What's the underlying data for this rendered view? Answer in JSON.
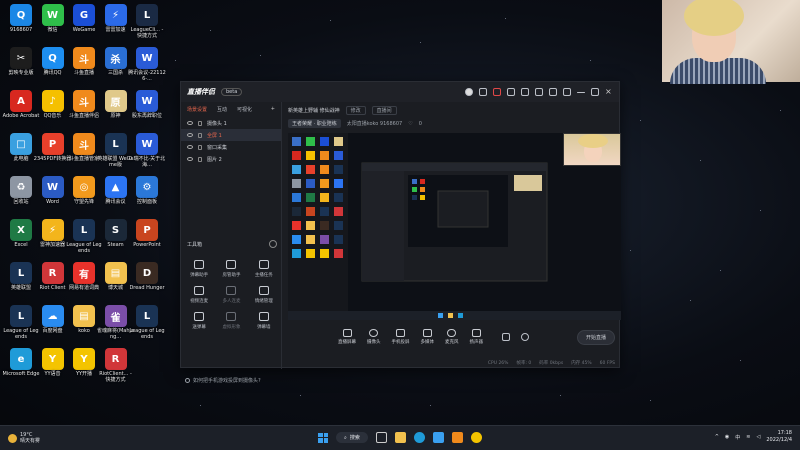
{
  "desktop": {
    "icons": [
      {
        "label": "9168607",
        "color": "#1b87e6",
        "glyph": "Q"
      },
      {
        "label": "微信",
        "color": "#2fbf4a",
        "glyph": "W"
      },
      {
        "label": "WeGame",
        "color": "#1b4fd6",
        "glyph": "G"
      },
      {
        "label": "雷雷加速",
        "color": "#2b6ae8",
        "glyph": "⚡"
      },
      {
        "label": "LeagueCli... - 快捷方式",
        "color": "#1a2a44",
        "glyph": "L"
      },
      {
        "label": "剪映专业版",
        "color": "#1d1d1d",
        "glyph": "✂"
      },
      {
        "label": "腾讯QQ",
        "color": "#1d8ef0",
        "glyph": "Q"
      },
      {
        "label": "斗鱼直播",
        "color": "#f08a1c",
        "glyph": "斗"
      },
      {
        "label": "三国杀",
        "color": "#2a6fd4",
        "glyph": "杀"
      },
      {
        "label": "腾讯会议-221126-...",
        "color": "#2a5bd7",
        "glyph": "W"
      },
      {
        "label": "Adobe Acrobat",
        "color": "#d8281f",
        "glyph": "A"
      },
      {
        "label": "QQ音乐",
        "color": "#f5c000",
        "glyph": "♪"
      },
      {
        "label": "斗鱼直播伴侣",
        "color": "#f08a1c",
        "glyph": "斗"
      },
      {
        "label": "原神",
        "color": "#e0c98a",
        "glyph": "原"
      },
      {
        "label": "股东再辞职位",
        "color": "#2a5bd7",
        "glyph": "W"
      },
      {
        "label": "此电脑",
        "color": "#3aa0e0",
        "glyph": "□"
      },
      {
        "label": "2345PDF转换器",
        "color": "#e8402b",
        "glyph": "P"
      },
      {
        "label": "斗鱼直播管家",
        "color": "#f08a1c",
        "glyph": "斗"
      },
      {
        "label": "英雄联盟 WeGame版",
        "color": "#1a3354",
        "glyph": "L"
      },
      {
        "label": "0 瑞不比·关于北海…",
        "color": "#2a5bd7",
        "glyph": "W"
      },
      {
        "label": "回收站",
        "color": "#8d96a3",
        "glyph": "♻"
      },
      {
        "label": "Word",
        "color": "#2b5bc4",
        "glyph": "W"
      },
      {
        "label": "守望先锋",
        "color": "#f29a1d",
        "glyph": "◎"
      },
      {
        "label": "腾讯会议",
        "color": "#2c74f2",
        "glyph": "▲"
      },
      {
        "label": "控制面板",
        "color": "#2b78d8",
        "glyph": "⚙"
      },
      {
        "label": "Excel",
        "color": "#1f7a45",
        "glyph": "X"
      },
      {
        "label": "雷神加速器",
        "color": "#f3b51c",
        "glyph": "⚡"
      },
      {
        "label": "League of Legends",
        "color": "#1a3354",
        "glyph": "L"
      },
      {
        "label": "Steam",
        "color": "#1b2838",
        "glyph": "S"
      },
      {
        "label": "PowerPoint",
        "color": "#c9451f",
        "glyph": "P"
      },
      {
        "label": "英雄联盟",
        "color": "#1a3354",
        "glyph": "L"
      },
      {
        "label": "Riot Client",
        "color": "#d13639",
        "glyph": "R"
      },
      {
        "label": "网易有道词典",
        "color": "#e8322b",
        "glyph": "有"
      },
      {
        "label": "博天城",
        "color": "#f2c14e",
        "glyph": "▤"
      },
      {
        "label": "Dread Hunger",
        "color": "#3a2a22",
        "glyph": "D"
      },
      {
        "label": "League of Legends",
        "color": "#1a3354",
        "glyph": "L"
      },
      {
        "label": "百度网盘",
        "color": "#2a8cf0",
        "glyph": "☁"
      },
      {
        "label": "koko",
        "color": "#f2c14e",
        "glyph": "▤"
      },
      {
        "label": "雀魂麻将(Mahjong...",
        "color": "#7b4ea8",
        "glyph": "雀"
      },
      {
        "label": "League of Legends",
        "color": "#1a3354",
        "glyph": "L"
      },
      {
        "label": "Microsoft Edge",
        "color": "#1f9bd8",
        "glyph": "e"
      },
      {
        "label": "YY语音",
        "color": "#f4c400",
        "glyph": "Y"
      },
      {
        "label": "YY开播",
        "color": "#f4c400",
        "glyph": "Y"
      },
      {
        "label": "RiotClient... - 快捷方式",
        "color": "#d13639",
        "glyph": "R"
      }
    ]
  },
  "app": {
    "name": "直播伴侣",
    "version_badge": "beta",
    "left_tabs": [
      "场景设置",
      "互动",
      "可视化"
    ],
    "sources": [
      {
        "label": "摄像头 1",
        "selected": false
      },
      {
        "label": "全屏 1",
        "selected": true
      },
      {
        "label": "窗口采集",
        "selected": false
      },
      {
        "label": "图片 2",
        "selected": false
      }
    ],
    "tools_header": "工具箱",
    "tools": [
      {
        "label": "弹幕助手",
        "dim": false
      },
      {
        "label": "房管助手",
        "dim": false
      },
      {
        "label": "主播任务",
        "dim": false
      },
      {
        "label": "视频连麦",
        "dim": false
      },
      {
        "label": "多人连麦",
        "dim": true
      },
      {
        "label": "情绪管理",
        "dim": false
      },
      {
        "label": "送弹幕",
        "dim": false
      },
      {
        "label": "虚拟形象",
        "dim": true
      },
      {
        "label": "弹幕墙",
        "dim": false
      }
    ],
    "hint": "如何把手机游戏投屏到摄像头?",
    "room_title": "新英雄上野辅 修仙战神",
    "room_tag": "修改",
    "room_tag2": "直播间",
    "category": "王者荣耀 · 职业陪练",
    "room_id": "太阳直播koko 9168607",
    "likes": "0",
    "controls": [
      "直播屏幕",
      "摄像头",
      "手机投屏",
      "多媒体",
      "麦克风",
      "扬声器"
    ],
    "start_label": "开始直播",
    "status": [
      "CPU 26%",
      "帧率: 0",
      "码率 0kbps",
      "内存 45%",
      "60 FPS"
    ]
  },
  "taskbar": {
    "weather_temp": "19°C",
    "weather_desc": "晴天有雾",
    "search_label": "搜索",
    "lang": "中",
    "time": "17:18",
    "date": "2022/12/4"
  }
}
